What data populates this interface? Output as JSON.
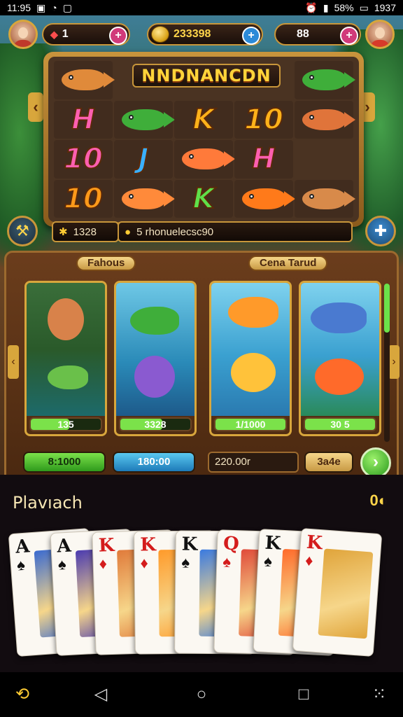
{
  "status_bar": {
    "time": "11:95",
    "battery": "58%",
    "clock_right": "1937"
  },
  "hud": {
    "lives": "1",
    "coins": "233398",
    "gems": "88"
  },
  "slot": {
    "title": "NNDNANCDN",
    "reels": [
      [
        {
          "type": "fish",
          "color": "#e08a3a"
        },
        {
          "type": "letter",
          "text": "H",
          "color": "#ff5fb0"
        },
        {
          "type": "letter",
          "text": "10",
          "color": "#ff5fb0"
        },
        {
          "type": "letter",
          "text": "10",
          "color": "#ff9a1a"
        }
      ],
      [
        {
          "type": "blank"
        },
        {
          "type": "fish",
          "color": "#3fae3a"
        },
        {
          "type": "letter",
          "text": "J",
          "color": "#3ab0ff"
        },
        {
          "type": "fish",
          "color": "#ff8a3a"
        }
      ],
      [
        {
          "type": "blank"
        },
        {
          "type": "letter",
          "text": "K",
          "color": "#ffb21a"
        },
        {
          "type": "fish",
          "color": "#ff7a3a"
        },
        {
          "type": "letter",
          "text": "K",
          "color": "#5fe04a"
        }
      ],
      [
        {
          "type": "blank"
        },
        {
          "type": "letter",
          "text": "10",
          "color": "#ffb21a"
        },
        {
          "type": "letter",
          "text": "H",
          "color": "#ff5fb0"
        },
        {
          "type": "fish",
          "color": "#ff7a1a"
        }
      ],
      [
        {
          "type": "fish",
          "color": "#3fae3a"
        },
        {
          "type": "fish",
          "color": "#e0743a"
        },
        {
          "type": "blank"
        },
        {
          "type": "fish",
          "color": "#d88a4a"
        }
      ]
    ]
  },
  "info": {
    "score": "1328",
    "message": "5 rhonuelecsc90"
  },
  "panel": {
    "tag_left": "Fahous",
    "tag_right": "Cena Tarud",
    "cards": [
      {
        "value": "135",
        "progress": 0.55,
        "bar_color": "#7be24a"
      },
      {
        "value": "3328",
        "progress": 0.6,
        "bar_color": "#7be24a"
      },
      {
        "value": "1/1000",
        "progress": 1.0,
        "bar_color": "#7be24a"
      },
      {
        "value": "30 5",
        "progress": 1.0,
        "bar_color": "#7be24a"
      }
    ],
    "bet_green": "8:1000",
    "bet_blue": "180:00",
    "bet_field": "220.00r",
    "bet_small": "3a4e",
    "go": "›"
  },
  "hand": {
    "title": "Plavıach",
    "count": "0",
    "cards": [
      {
        "rank": "A",
        "suit": "♠",
        "color": "black",
        "art": "#3a6ad0"
      },
      {
        "rank": "A",
        "suit": "♠",
        "color": "black",
        "art": "#4a3ab0"
      },
      {
        "rank": "K",
        "suit": "♦",
        "color": "red",
        "art": "#e07a3a"
      },
      {
        "rank": "K",
        "suit": "♦",
        "color": "red",
        "art": "#ff9a2a"
      },
      {
        "rank": "K",
        "suit": "♠",
        "color": "black",
        "art": "#3a7ae0"
      },
      {
        "rank": "Q",
        "suit": "♠",
        "color": "red",
        "art": "#e04a3a"
      },
      {
        "rank": "K",
        "suit": "♠",
        "color": "black",
        "art": "#ff6a2a"
      },
      {
        "rank": "K",
        "suit": "♦",
        "color": "red",
        "art": "#e0a43a"
      }
    ]
  },
  "nav": {
    "icons": [
      "back-swipe-icon",
      "back-icon",
      "home-icon",
      "recents-icon",
      "apps-grid-icon"
    ]
  }
}
